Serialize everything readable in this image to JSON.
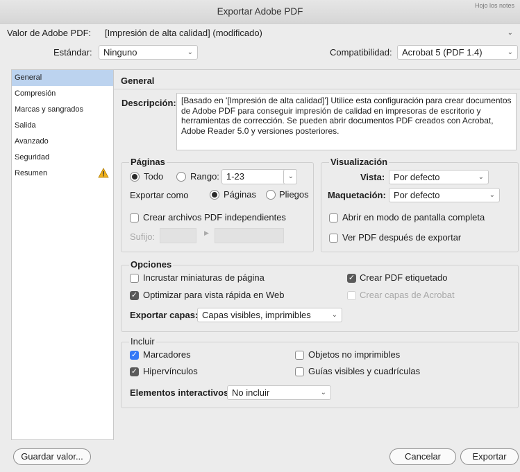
{
  "window": {
    "title": "Exportar Adobe PDF",
    "corner_text": "Hojo los notes"
  },
  "header": {
    "preset_label": "Valor de Adobe PDF:",
    "preset_value": "[Impresión de alta calidad] (modificado)",
    "standard_label": "Estándar:",
    "standard_value": "Ninguno",
    "compat_label": "Compatibilidad:",
    "compat_value": "Acrobat 5 (PDF 1.4)"
  },
  "sidebar": {
    "items": [
      {
        "label": "General"
      },
      {
        "label": "Compresión"
      },
      {
        "label": "Marcas y sangrados"
      },
      {
        "label": "Salida"
      },
      {
        "label": "Avanzado"
      },
      {
        "label": "Seguridad"
      },
      {
        "label": "Resumen"
      }
    ]
  },
  "general": {
    "section_title": "General",
    "desc_label": "Descripción:",
    "desc_text": "[Basado en '[Impresión de alta calidad]'] Utilice esta configuración para crear documentos de Adobe PDF para conseguir impresión de calidad en impresoras de escritorio y herramientas de corrección. Se pueden abrir documentos PDF creados con Acrobat, Adobe Reader 5.0 y versiones posteriores."
  },
  "pages": {
    "title": "Páginas",
    "all_label": "Todo",
    "range_label": "Rango:",
    "range_value": "1-23",
    "export_as_label": "Exportar como",
    "pages_label": "Páginas",
    "spreads_label": "Pliegos",
    "separate_label": "Crear archivos PDF independientes",
    "suffix_label": "Sufijo:"
  },
  "view": {
    "title": "Visualización",
    "view_label": "Vista:",
    "view_value": "Por defecto",
    "layout_label": "Maquetación:",
    "layout_value": "Por defecto",
    "fullscreen_label": "Abrir en modo de pantalla completa",
    "view_after_label": "Ver PDF después de exportar"
  },
  "options": {
    "title": "Opciones",
    "thumbnails_label": "Incrustar miniaturas de página",
    "optimize_label": "Optimizar para vista rápida en Web",
    "tagged_label": "Crear PDF etiquetado",
    "acrobat_layers_label": "Crear capas de Acrobat",
    "export_layers_label": "Exportar capas:",
    "export_layers_value": "Capas visibles, imprimibles"
  },
  "include": {
    "title": "Incluir",
    "bookmarks_label": "Marcadores",
    "hyperlinks_label": "Hipervínculos",
    "nonprinting_label": "Objetos no imprimibles",
    "guides_label": "Guías visibles y cuadrículas",
    "interactive_label": "Elementos interactivos:",
    "interactive_value": "No incluir"
  },
  "footer": {
    "save_preset_label": "Guardar valor...",
    "cancel_label": "Cancelar",
    "export_label": "Exportar"
  },
  "colors": {
    "accent": "#3478f6",
    "selection": "#bcd3ef",
    "warning": "#f2b21b"
  }
}
